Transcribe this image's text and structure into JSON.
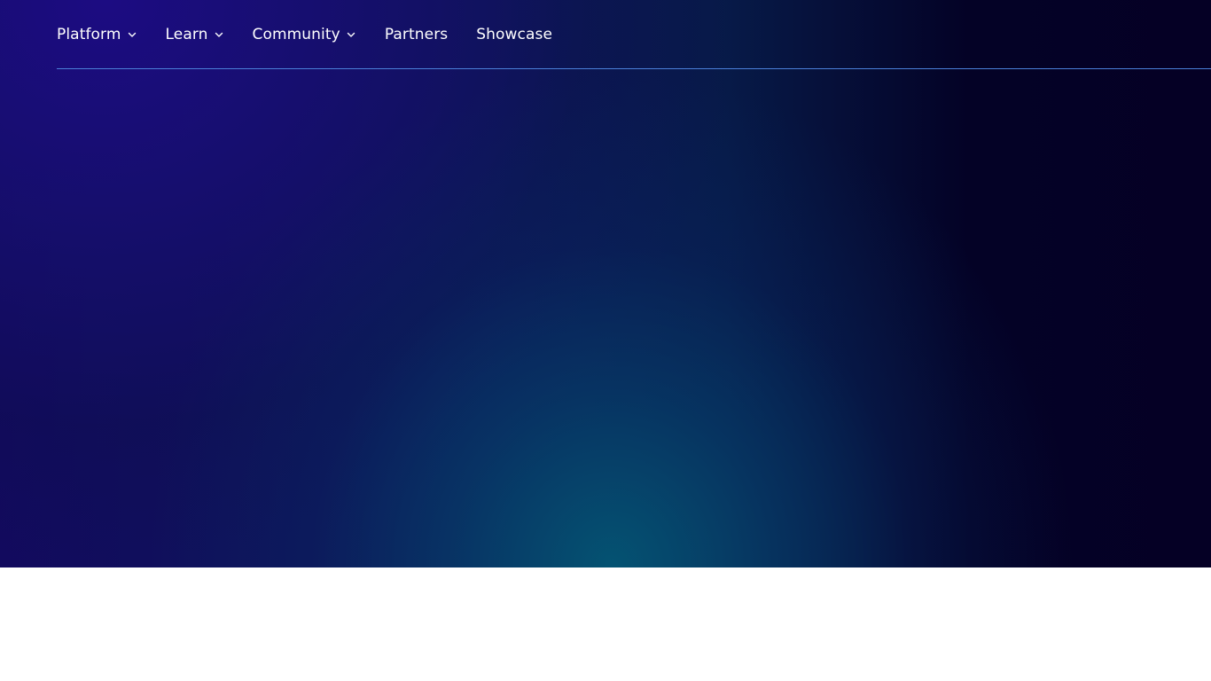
{
  "nav": {
    "items": [
      {
        "label": "Platform",
        "has_dropdown": true,
        "icon": "chevron-down-icon"
      },
      {
        "label": "Learn",
        "has_dropdown": true,
        "icon": "chevron-down-icon"
      },
      {
        "label": "Community",
        "has_dropdown": true,
        "icon": "chevron-down-icon"
      },
      {
        "label": "Partners",
        "has_dropdown": false
      },
      {
        "label": "Showcase",
        "has_dropdown": false
      }
    ]
  },
  "colors": {
    "hero_dark": "#050025",
    "hero_violet": "#1c0c82",
    "hero_teal": "#045674",
    "nav_divider": "#4a7fd8",
    "nav_text": "#ffffff",
    "page_background": "#ffffff"
  }
}
